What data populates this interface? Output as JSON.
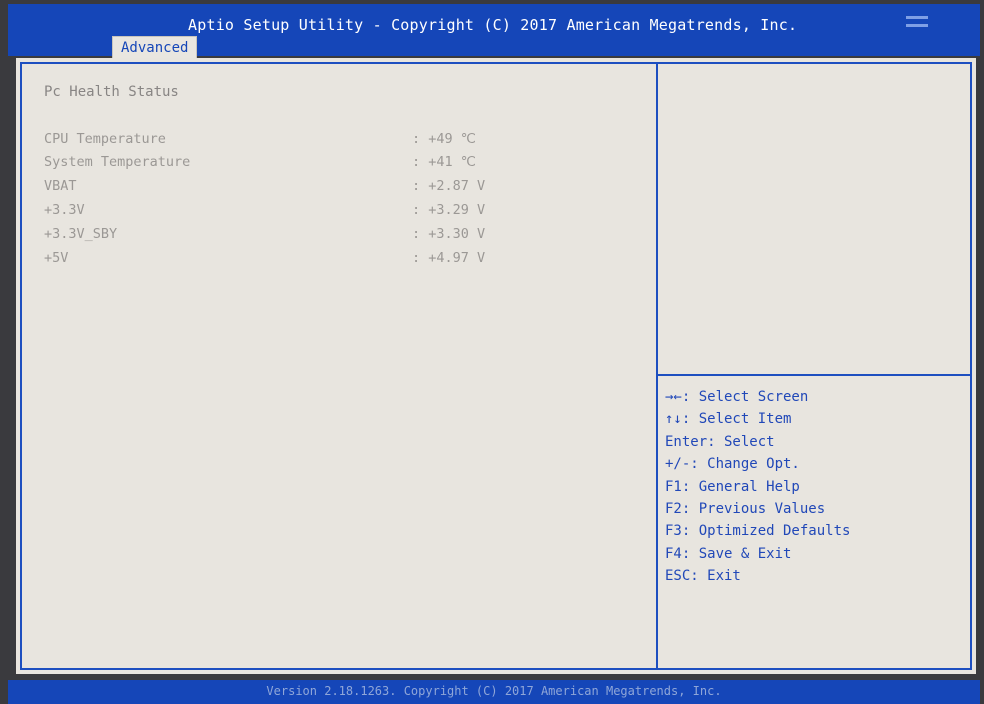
{
  "header": {
    "title": "Aptio Setup Utility - Copyright (C) 2017 American Megatrends, Inc.",
    "active_tab": "Advanced",
    "menu_icon": "hamburger-menu-icon"
  },
  "main": {
    "section_title": "Pc Health Status",
    "rows": [
      {
        "label": "CPU Temperature",
        "value": ": +49 ℃"
      },
      {
        "label": "System Temperature",
        "value": ": +41 ℃"
      },
      {
        "label": "VBAT",
        "value": ": +2.87 V"
      },
      {
        "label": "+3.3V",
        "value": ": +3.29 V"
      },
      {
        "label": "+3.3V_SBY",
        "value": ": +3.30 V"
      },
      {
        "label": "+5V",
        "value": ": +4.97 V"
      }
    ]
  },
  "help": {
    "lines": [
      "→←: Select Screen",
      "↑↓: Select Item",
      "Enter: Select",
      "+/-: Change Opt.",
      "F1: General Help",
      "F2: Previous Values",
      "F3: Optimized Defaults",
      "F4: Save & Exit",
      "ESC: Exit"
    ]
  },
  "footer": {
    "text": "Version 2.18.1263. Copyright (C) 2017 American Megatrends, Inc."
  },
  "colors": {
    "bios_blue": "#1546b8",
    "panel_bg": "#e8e5df",
    "help_text": "#2148b8",
    "value_text": "#9b9895"
  }
}
